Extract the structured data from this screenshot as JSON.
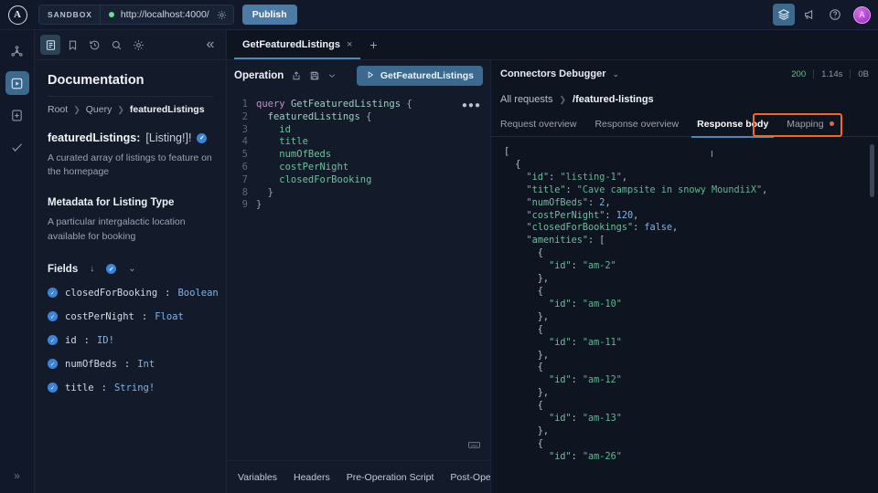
{
  "topbar": {
    "logo_icon": "apollo-logo-icon",
    "env_label": "SANDBOX",
    "status_dot": "connected-dot",
    "url": "http://localhost:4000/",
    "url_gear_icon": "gear-icon",
    "publish_label": "Publish",
    "icons": [
      {
        "name": "layers-icon",
        "glyph": "◈",
        "active": true
      },
      {
        "name": "megaphone-icon",
        "glyph": "📣",
        "active": false
      },
      {
        "name": "help-circle-icon",
        "glyph": "?",
        "active": false
      }
    ],
    "avatar_label": "A"
  },
  "rail": {
    "items": [
      {
        "name": "schema-graph-icon",
        "active": false
      },
      {
        "name": "explorer-icon",
        "active": true
      },
      {
        "name": "document-add-icon",
        "active": false
      },
      {
        "name": "checkmark-icon",
        "active": false
      }
    ],
    "expand_label": "»"
  },
  "docs": {
    "toolbar": [
      {
        "name": "documentation-icon",
        "active": true
      },
      {
        "name": "bookmark-icon",
        "active": false
      },
      {
        "name": "history-icon",
        "active": false
      },
      {
        "name": "search-icon",
        "active": false
      },
      {
        "name": "settings-gear-icon",
        "active": false
      }
    ],
    "collapse_label": "«",
    "title": "Documentation",
    "breadcrumbs": [
      "Root",
      "Query",
      "featuredListings"
    ],
    "field_title": "featuredListings:",
    "field_type": "[Listing!]!",
    "description": "A curated array of listings to feature on the homepage",
    "metadata_heading": "Metadata for Listing Type",
    "metadata_description": "A particular intergalactic location available for booking",
    "fields_label": "Fields",
    "fields_sort_icon": "arrow-down-icon",
    "fields_check_icon": "check-badge-icon",
    "fields_chevron_icon": "chevron-down-icon",
    "fields": [
      {
        "name": "closedForBooking",
        "type": "Boolean"
      },
      {
        "name": "costPerNight",
        "type": "Float"
      },
      {
        "name": "id",
        "type": "ID!"
      },
      {
        "name": "numOfBeds",
        "type": "Int"
      },
      {
        "name": "title",
        "type": "String!"
      }
    ]
  },
  "tabs": {
    "items": [
      {
        "label": "GetFeaturedListings",
        "close_icon": "close-icon",
        "active": true
      }
    ],
    "add_label": "+"
  },
  "operation": {
    "title": "Operation",
    "share_icon": "share-icon",
    "save_icon": "save-icon",
    "chevron_icon": "chevron-down-icon",
    "run_label": "GetFeaturedListings",
    "run_icon": "play-icon",
    "menu_icon": "more-options-icon",
    "format_icon": "keyboard-icon",
    "code_lines": [
      {
        "n": "1",
        "segments": [
          [
            "kw",
            "query "
          ],
          [
            "fn",
            "GetFeaturedListings"
          ],
          [
            "pn",
            " {"
          ]
        ]
      },
      {
        "n": "2",
        "segments": [
          [
            "pn",
            "  "
          ],
          [
            "fn",
            "featuredListings"
          ],
          [
            "pn",
            " {"
          ]
        ]
      },
      {
        "n": "3",
        "segments": [
          [
            "fld",
            "    id"
          ]
        ]
      },
      {
        "n": "4",
        "segments": [
          [
            "fld",
            "    title"
          ]
        ]
      },
      {
        "n": "5",
        "segments": [
          [
            "fld",
            "    numOfBeds"
          ]
        ]
      },
      {
        "n": "6",
        "segments": [
          [
            "fld",
            "    costPerNight"
          ]
        ]
      },
      {
        "n": "7",
        "segments": [
          [
            "fld",
            "    closedForBooking"
          ]
        ]
      },
      {
        "n": "8",
        "segments": [
          [
            "pn",
            "  }"
          ]
        ]
      },
      {
        "n": "9",
        "segments": [
          [
            "pn",
            "}"
          ]
        ]
      }
    ],
    "bottom_tabs": [
      "Variables",
      "Headers",
      "Pre-Operation Script",
      "Post-Ope"
    ]
  },
  "debugger": {
    "title": "Connectors Debugger",
    "chevron_icon": "chevron-down-icon",
    "status_code": "200",
    "duration": "1.14s",
    "size": "0B",
    "breadcrumbs": [
      "All requests",
      "/featured-listings"
    ],
    "tabs": [
      {
        "label": "Request overview",
        "active": false,
        "dot": false
      },
      {
        "label": "Response overview",
        "active": false,
        "dot": false
      },
      {
        "label": "Response body",
        "active": true,
        "dot": false
      },
      {
        "label": "Mapping",
        "active": false,
        "dot": true
      }
    ],
    "highlight_color": "#f26a1b",
    "response_body": [
      [
        [
          "jp",
          "["
        ]
      ],
      [
        [
          "jp",
          "  {"
        ]
      ],
      [
        [
          "jp",
          "    "
        ],
        [
          "jk",
          "\"id\""
        ],
        [
          "jp",
          ": "
        ],
        [
          "js",
          "\"listing-1\""
        ],
        [
          "jp",
          ","
        ]
      ],
      [
        [
          "jp",
          "    "
        ],
        [
          "jk",
          "\"title\""
        ],
        [
          "jp",
          ": "
        ],
        [
          "js",
          "\"Cave campsite in snowy MoundiiX\""
        ],
        [
          "jp",
          ","
        ]
      ],
      [
        [
          "jp",
          "    "
        ],
        [
          "jk",
          "\"numOfBeds\""
        ],
        [
          "jp",
          ": "
        ],
        [
          "jn",
          "2"
        ],
        [
          "jp",
          ","
        ]
      ],
      [
        [
          "jp",
          "    "
        ],
        [
          "jk",
          "\"costPerNight\""
        ],
        [
          "jp",
          ": "
        ],
        [
          "jn",
          "120"
        ],
        [
          "jp",
          ","
        ]
      ],
      [
        [
          "jp",
          "    "
        ],
        [
          "jk",
          "\"closedForBookings\""
        ],
        [
          "jp",
          ": "
        ],
        [
          "jb",
          "false"
        ],
        [
          "jp",
          ","
        ]
      ],
      [
        [
          "jp",
          "    "
        ],
        [
          "jk",
          "\"amenities\""
        ],
        [
          "jp",
          ": ["
        ]
      ],
      [
        [
          "jp",
          "      {"
        ]
      ],
      [
        [
          "jp",
          "        "
        ],
        [
          "jk",
          "\"id\""
        ],
        [
          "jp",
          ": "
        ],
        [
          "js",
          "\"am-2\""
        ]
      ],
      [
        [
          "jp",
          "      },"
        ]
      ],
      [
        [
          "jp",
          "      {"
        ]
      ],
      [
        [
          "jp",
          "        "
        ],
        [
          "jk",
          "\"id\""
        ],
        [
          "jp",
          ": "
        ],
        [
          "js",
          "\"am-10\""
        ]
      ],
      [
        [
          "jp",
          "      },"
        ]
      ],
      [
        [
          "jp",
          "      {"
        ]
      ],
      [
        [
          "jp",
          "        "
        ],
        [
          "jk",
          "\"id\""
        ],
        [
          "jp",
          ": "
        ],
        [
          "js",
          "\"am-11\""
        ]
      ],
      [
        [
          "jp",
          "      },"
        ]
      ],
      [
        [
          "jp",
          "      {"
        ]
      ],
      [
        [
          "jp",
          "        "
        ],
        [
          "jk",
          "\"id\""
        ],
        [
          "jp",
          ": "
        ],
        [
          "js",
          "\"am-12\""
        ]
      ],
      [
        [
          "jp",
          "      },"
        ]
      ],
      [
        [
          "jp",
          "      {"
        ]
      ],
      [
        [
          "jp",
          "        "
        ],
        [
          "jk",
          "\"id\""
        ],
        [
          "jp",
          ": "
        ],
        [
          "js",
          "\"am-13\""
        ]
      ],
      [
        [
          "jp",
          "      },"
        ]
      ],
      [
        [
          "jp",
          "      {"
        ]
      ],
      [
        [
          "jp",
          "        "
        ],
        [
          "jk",
          "\"id\""
        ],
        [
          "jp",
          ": "
        ],
        [
          "js",
          "\"am-26\""
        ]
      ]
    ]
  }
}
